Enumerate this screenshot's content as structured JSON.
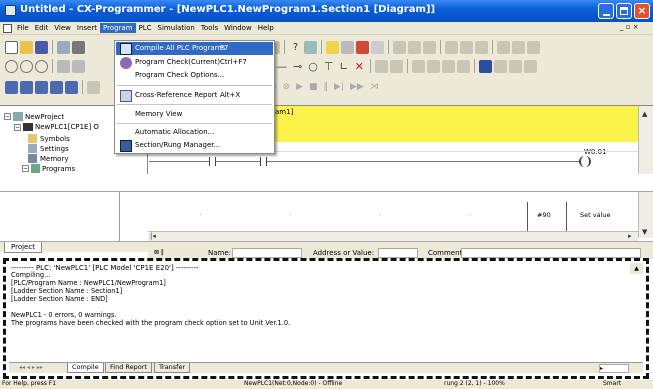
{
  "window": {
    "title": "Untitled - CX-Programmer - [NewPLC1.NewProgram1.Section1 [Diagram]]",
    "buttons": [
      "_",
      "□",
      "×"
    ]
  },
  "menubar": [
    "File",
    "Edit",
    "View",
    "Insert",
    "Program",
    "PLC",
    "Simulation",
    "Tools",
    "Window",
    "Help"
  ],
  "menubar_right": "_ ▫ ×",
  "dropdown": {
    "items": [
      {
        "label": "Compile All PLC Programs",
        "shortcut": "F7",
        "highlighted": true,
        "icon": "compile-icon"
      },
      {
        "label": "Program Check(Current)",
        "shortcut": "Ctrl+F7",
        "icon": "check-icon"
      },
      {
        "label": "Program Check Options...",
        "shortcut": "",
        "icon": ""
      },
      {
        "label": "Cross-Reference Report",
        "shortcut": "Alt+X",
        "icon": "report-icon"
      },
      {
        "label": "Memory View",
        "shortcut": "",
        "icon": ""
      },
      {
        "label": "Automatic Allocation...",
        "shortcut": "",
        "icon": ""
      },
      {
        "label": "Section/Rung Manager...",
        "shortcut": "",
        "icon": "manager-icon"
      }
    ]
  },
  "tree": {
    "root": "NewProject",
    "plc": "NewPLC1[CP1E] O",
    "items": [
      "Symbols",
      "Settings",
      "Memory",
      "Programs"
    ]
  },
  "diagram": {
    "header": "am1]",
    "output_address": "W0.01"
  },
  "lower_diagram": {
    "cell_value": "#90",
    "cell_label": "Set value"
  },
  "project_tab": "Project",
  "status_fields": {
    "name": "Name:",
    "address": "Address or Value:",
    "comment": "Comment:"
  },
  "output": {
    "lines": [
      "--------- PLC: 'NewPLC1' [PLC Model 'CP1E E20'] ---------",
      "Compiling...",
      "[PLC/Program Name : NewPLC1/NewProgram1]",
      "[Ladder Section Name : Section1]",
      "[Ladder Section Name : END]",
      "",
      "NewPLC1 - 0 errors, 0 warnings.",
      "The programs have been checked with the program check option set to Unit Ver.1.0."
    ],
    "tabs": [
      "Compile",
      "Find Report",
      "Transfer"
    ]
  },
  "statusbar": {
    "help": "For Help, press F1",
    "plc": "NewPLC1(Net:0,Node:0) - Offline",
    "rung": "rung 2 (2, 1) - 100%",
    "mode": "Smart"
  },
  "colors": {
    "title_bar": "#0a5fd8",
    "menu_highlight": "#316ac5",
    "diagram_yellow": "#fbf34a"
  }
}
